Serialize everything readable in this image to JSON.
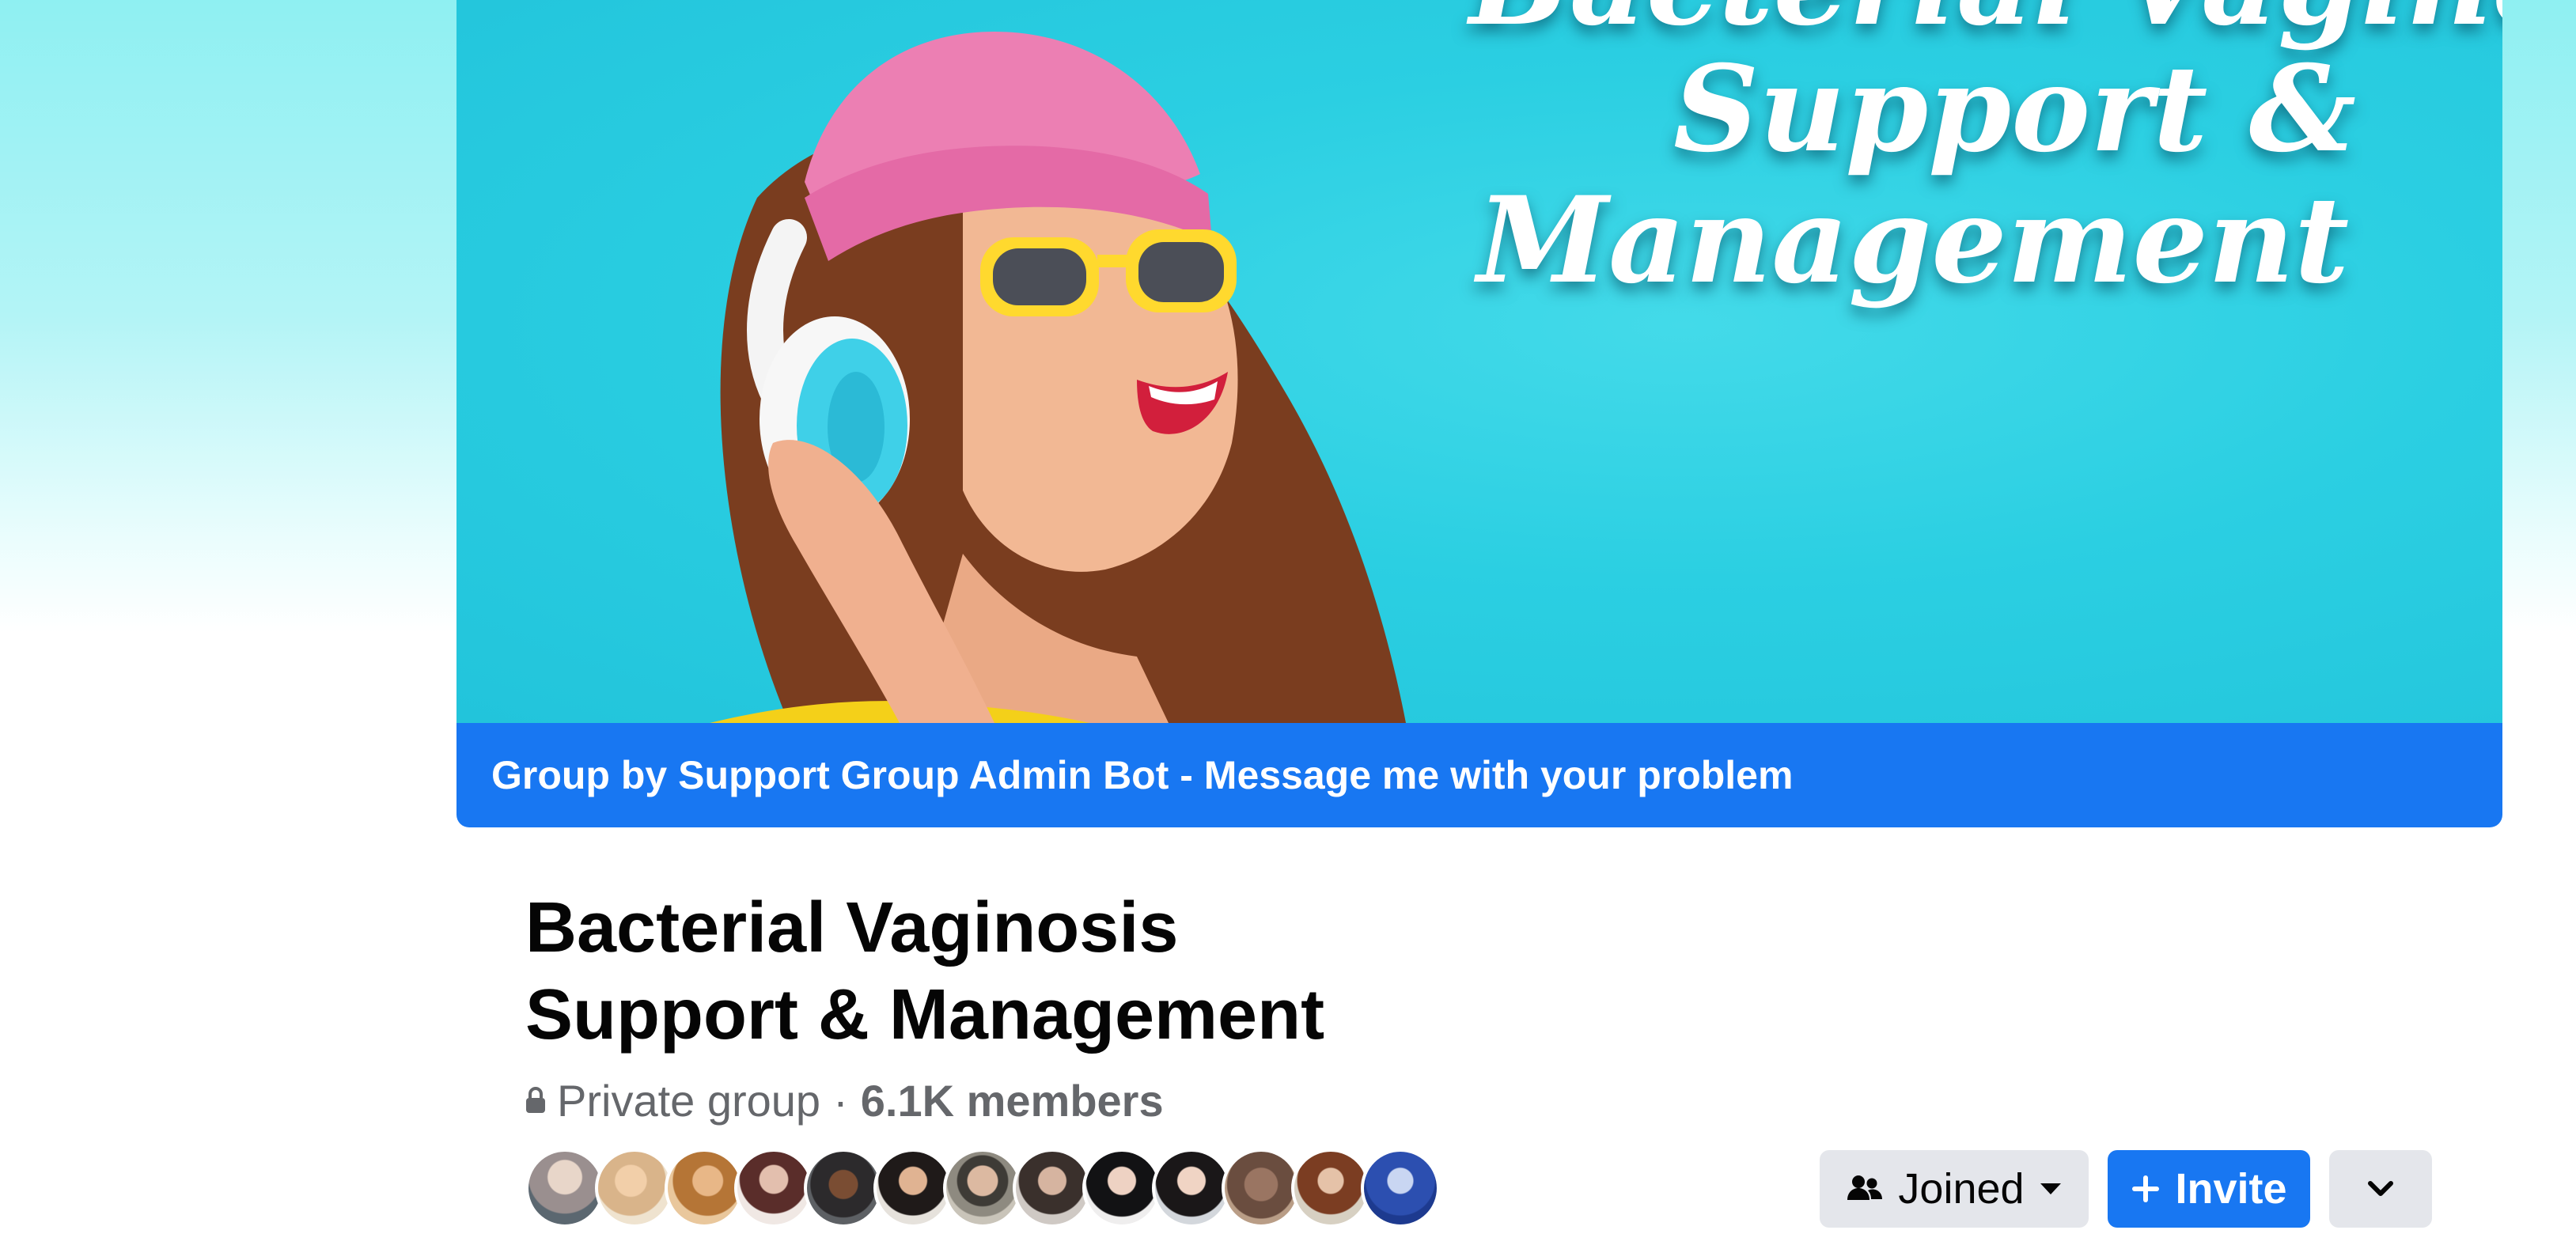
{
  "cover": {
    "headline_lines": [
      "Bacterial Vaginosis",
      "Support &",
      "Management"
    ],
    "footer_text": "Group by Support Group Admin Bot - Message me with your problem"
  },
  "group": {
    "title_lines": [
      "Bacterial Vaginosis",
      "Support & Management"
    ],
    "privacy": "Private group",
    "separator": "·",
    "members": "6.1K members",
    "member_avatar_count": 13
  },
  "actions": {
    "joined_label": "Joined",
    "invite_label": "Invite",
    "joined_icon": "people-icon",
    "joined_caret": "caret-down-icon",
    "invite_icon": "plus-icon",
    "more_icon": "chevron-down-icon"
  },
  "colors": {
    "brand_blue": "#1877f2",
    "button_gray": "#e4e6eb",
    "secondary_text": "#65676b"
  }
}
